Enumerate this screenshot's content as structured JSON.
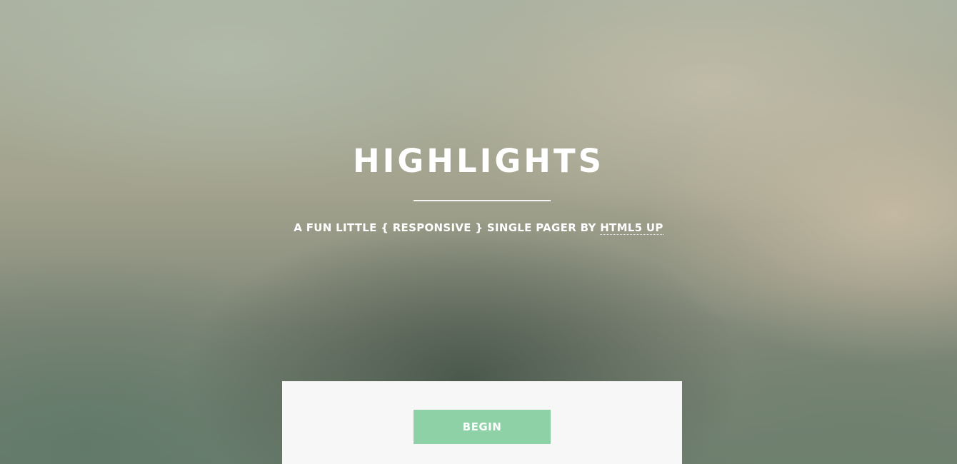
{
  "header": {
    "title": "HIGHLIGHTS",
    "subtitle_prefix": "A FUN LITTLE { RESPONSIVE } SINGLE PAGER BY ",
    "subtitle_link": "HTML5 UP"
  },
  "main": {
    "begin_label": "BEGIN"
  },
  "colors": {
    "accent": "#8fd1a7",
    "panel": "#f6f7f6",
    "text": "#ffffff"
  }
}
